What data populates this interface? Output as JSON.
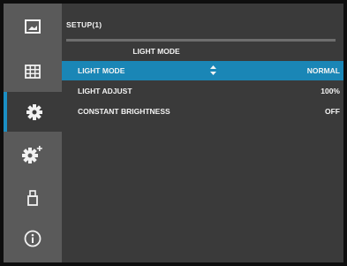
{
  "screen": {
    "title": "SETUP(1)",
    "subtitle": "LIGHT MODE"
  },
  "sidebar": {
    "items": [
      {
        "icon": "picture-icon"
      },
      {
        "icon": "grid-icon"
      },
      {
        "icon": "gear-icon",
        "active": true
      },
      {
        "icon": "gear-plus-icon"
      },
      {
        "icon": "usb-icon"
      },
      {
        "icon": "info-icon"
      }
    ]
  },
  "menu": {
    "rows": [
      {
        "label": "LIGHT MODE",
        "value": "NORMAL",
        "selected": true
      },
      {
        "label": "LIGHT ADJUST",
        "value": "100%"
      },
      {
        "label": "CONSTANT BRIGHTNESS",
        "value": "OFF"
      }
    ]
  },
  "colors": {
    "background": "#3a3a3a",
    "sidebar": "#5a5a5a",
    "accent": "#1a86b6",
    "text": "#f4f4f4"
  }
}
